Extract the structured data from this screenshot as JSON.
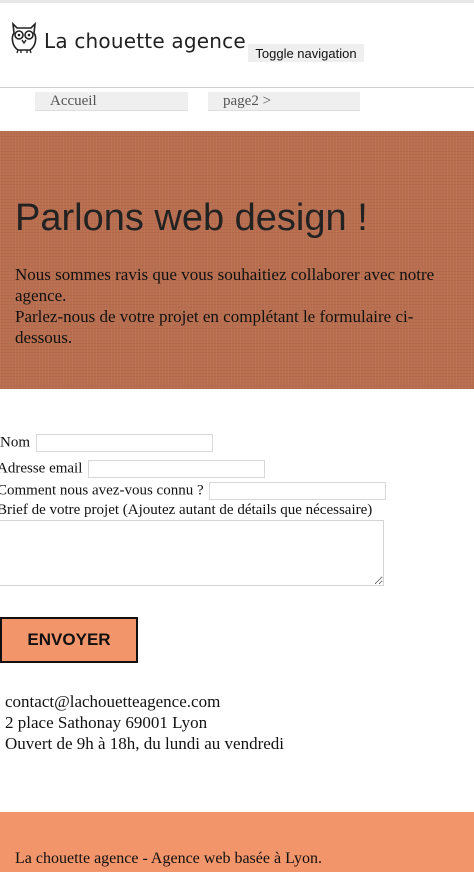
{
  "header": {
    "logo_icon": "owl-icon",
    "brand": "La chouette agence",
    "toggle_label": "Toggle navigation"
  },
  "nav": {
    "items": [
      {
        "label": "Accueil"
      },
      {
        "label": "page2 >"
      }
    ]
  },
  "hero": {
    "title": "Parlons web design !",
    "line1": "Nous sommes ravis que vous souhaitiez collaborer avec notre agence.",
    "line2": "Parlez-nous de votre projet en complétant le formulaire ci-dessous."
  },
  "form": {
    "name_label": "Nom",
    "email_label": "Adresse email",
    "source_label": "Comment nous avez-vous connu ?",
    "brief_label": "Brief de votre projet (Ajoutez autant de détails que nécessaire)",
    "submit_label": "ENVOYER"
  },
  "contact": {
    "email": "contact@lachouetteagence.com",
    "address": "2 place Sathonay 69001 Lyon",
    "hours": "Ouvert de 9h à 18h, du lundi au vendredi"
  },
  "footer": {
    "text": "La chouette agence - Agence web basée à Lyon."
  },
  "colors": {
    "hero_bg": "#b96e4f",
    "accent": "#f3956a"
  }
}
